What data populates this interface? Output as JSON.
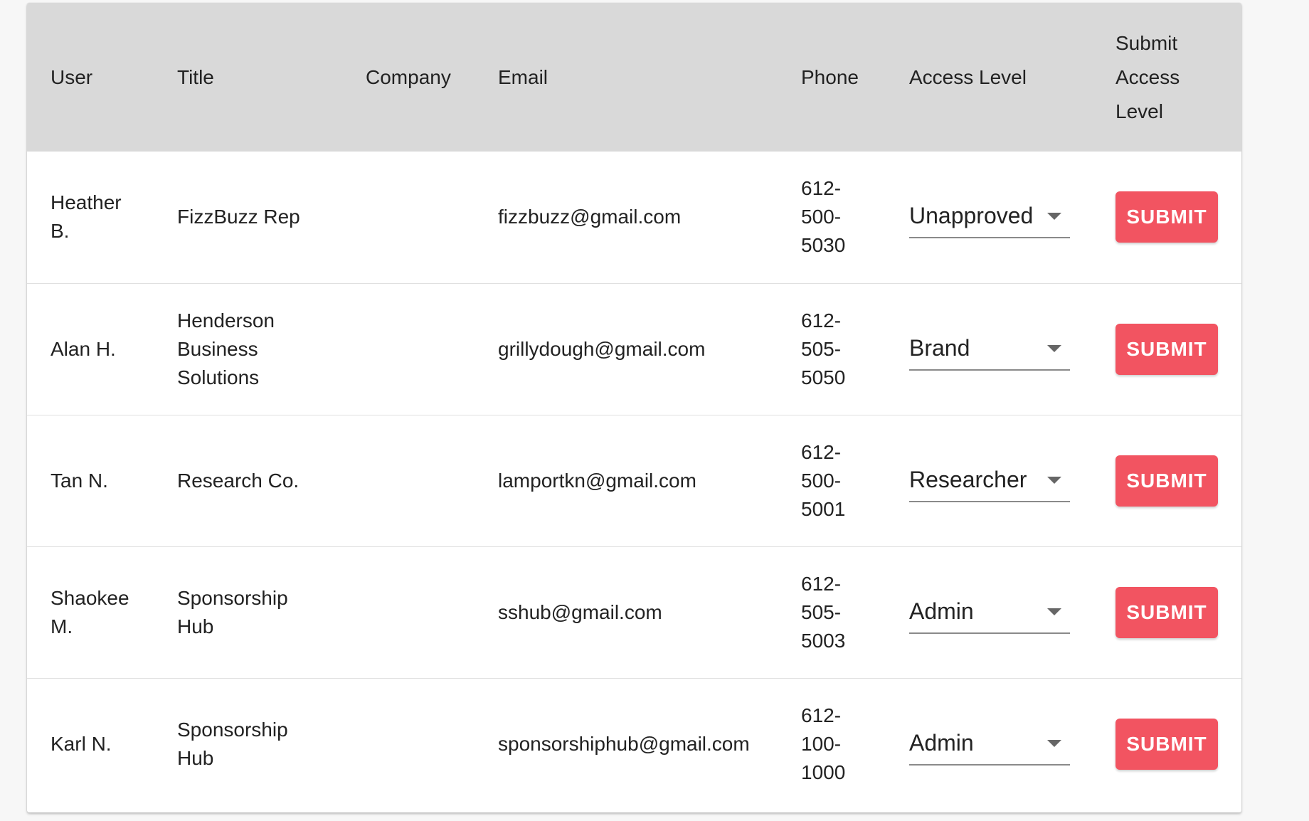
{
  "headers": {
    "user": "User",
    "title": "Title",
    "company": "Company",
    "email": "Email",
    "phone": "Phone",
    "access_level": "Access Level",
    "submit_access_level": "Submit Access Level"
  },
  "rows": [
    {
      "user": "Heather B.",
      "title": "FizzBuzz Rep",
      "company": "",
      "email": "fizzbuzz@gmail.com",
      "phone": "612-500-5030",
      "access_level": "Unapproved",
      "button": "SUBMIT"
    },
    {
      "user": "Alan H.",
      "title": "Henderson Business Solutions",
      "company": "",
      "email": "grillydough@gmail.com",
      "phone": "612-505-5050",
      "access_level": "Brand",
      "button": "SUBMIT"
    },
    {
      "user": "Tan N.",
      "title": "Research Co.",
      "company": "",
      "email": "lamportkn@gmail.com",
      "phone": "612-500-5001",
      "access_level": "Researcher",
      "button": "SUBMIT"
    },
    {
      "user": "Shaokee M.",
      "title": "Sponsorship Hub",
      "company": "",
      "email": "sshub@gmail.com",
      "phone": "612-505-5003",
      "access_level": "Admin",
      "button": "SUBMIT"
    },
    {
      "user": "Karl N.",
      "title": "Sponsorship Hub",
      "company": "",
      "email": "sponsorshiphub@gmail.com",
      "phone": "612-100-1000",
      "access_level": "Admin",
      "button": "SUBMIT"
    }
  ],
  "colors": {
    "header_bg": "#d9d9d9",
    "submit_button": "#f25461"
  },
  "icons": {
    "dropdown": "chevron-down-icon"
  }
}
